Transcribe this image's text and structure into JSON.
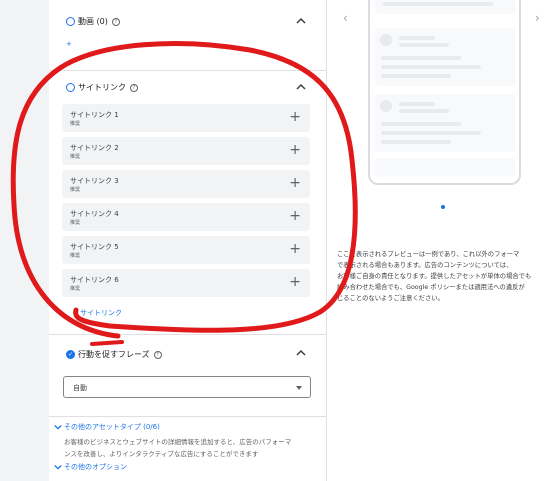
{
  "sections": {
    "video": {
      "title": "動画 (0)",
      "add_link": "+"
    },
    "sitelinks": {
      "title": "サイトリンク",
      "items": [
        {
          "label": "サイトリンク 1",
          "sub": "推奨"
        },
        {
          "label": "サイトリンク 2",
          "sub": "推奨"
        },
        {
          "label": "サイトリンク 3",
          "sub": "推奨"
        },
        {
          "label": "サイトリンク 4",
          "sub": "推奨"
        },
        {
          "label": "サイトリンク 5",
          "sub": "推奨"
        },
        {
          "label": "サイトリンク 6",
          "sub": "推奨"
        }
      ],
      "add_link": "サイトリンク"
    },
    "cta": {
      "title": "行動を促すフレーズ",
      "select_value": "自動"
    },
    "other_assets": {
      "title": "その他のアセットタイプ (0/6)",
      "desc_line1": "お客様のビジネスとウェブサイトの詳細情報を追加すると、広告のパフォーマ",
      "desc_line2": "ンスを改善し、よりインタラクティブな広告にすることができます"
    },
    "other_options": {
      "title": "その他のオプション"
    }
  },
  "preview": {
    "notice_lines": [
      "ここに表示されるプレビューは一例であり、これ以外のフォーマ",
      "で表示される場合もあります。広告のコンテンツについては、",
      "お客様ご自身の責任となります。提供したアセットが単体の場合でも",
      "組み合わせた場合でも、Google ポリシーまたは適用法への違反が",
      "じることのないようご注意ください。"
    ]
  },
  "colors": {
    "accent": "#1a73e8",
    "annotation": "#e0191b"
  }
}
